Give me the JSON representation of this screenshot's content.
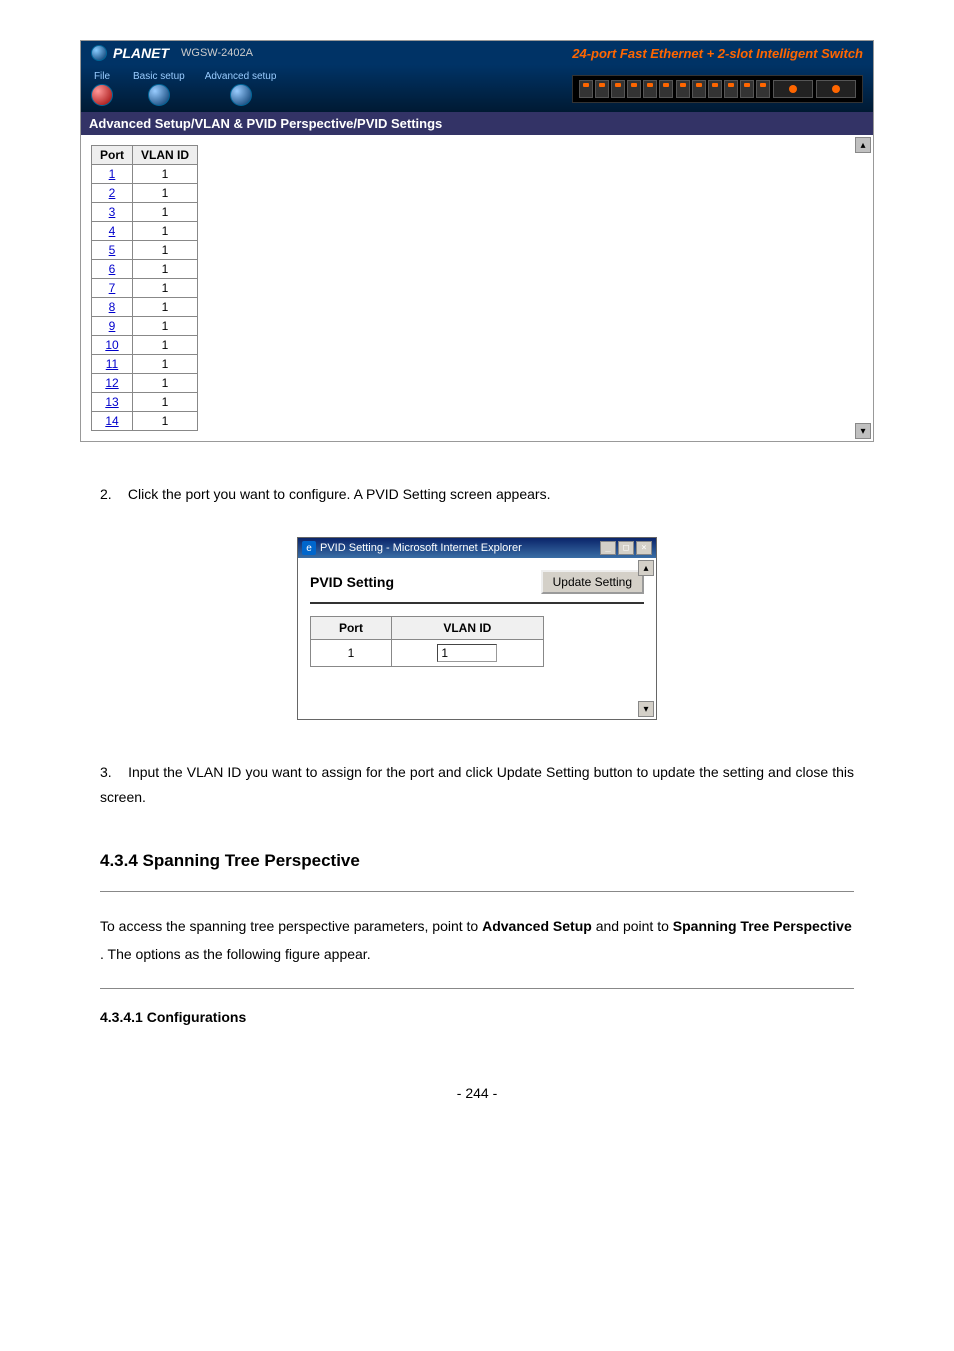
{
  "banner": {
    "brand": "PLANET",
    "model": "WGSW-2402A",
    "tagline": "24-port Fast Ethernet + 2-slot Intelligent Switch"
  },
  "menu": {
    "file": "File",
    "basic": "Basic setup",
    "advanced": "Advanced setup"
  },
  "screenshot1": {
    "section_title": "Advanced Setup/VLAN & PVID Perspective/PVID Settings",
    "table_headers": {
      "port": "Port",
      "vlanid": "VLAN ID"
    },
    "rows": [
      {
        "port": "1",
        "vlanid": "1"
      },
      {
        "port": "2",
        "vlanid": "1"
      },
      {
        "port": "3",
        "vlanid": "1"
      },
      {
        "port": "4",
        "vlanid": "1"
      },
      {
        "port": "5",
        "vlanid": "1"
      },
      {
        "port": "6",
        "vlanid": "1"
      },
      {
        "port": "7",
        "vlanid": "1"
      },
      {
        "port": "8",
        "vlanid": "1"
      },
      {
        "port": "9",
        "vlanid": "1"
      },
      {
        "port": "10",
        "vlanid": "1"
      },
      {
        "port": "11",
        "vlanid": "1"
      },
      {
        "port": "12",
        "vlanid": "1"
      },
      {
        "port": "13",
        "vlanid": "1"
      },
      {
        "port": "14",
        "vlanid": "1"
      }
    ]
  },
  "instruction2": {
    "num": "2.",
    "text": "Click the port you want to configure.    A PVID Setting screen appears."
  },
  "dialog": {
    "titlebar": "PVID Setting - Microsoft Internet Explorer",
    "heading": "PVID Setting",
    "update_btn": "Update Setting",
    "th_port": "Port",
    "th_vlanid": "VLAN ID",
    "port_val": "1",
    "vlan_input": "1"
  },
  "instruction3": {
    "num": "3.",
    "text": "Input the VLAN ID you want to assign for the port and click Update Setting button to update the setting and close this screen."
  },
  "section": {
    "heading": "4.3.4 Spanning Tree Perspective",
    "intro_before": "To access the spanning tree perspective parameters, point to ",
    "intro_bold1": "Advanced Setup",
    "intro_mid": " and point to ",
    "intro_bold2": "Spanning Tree Perspective",
    "intro_after": ". The options as the following figure appear.",
    "sub": "4.3.4.1 Configurations"
  },
  "page_number": "- 244 -"
}
